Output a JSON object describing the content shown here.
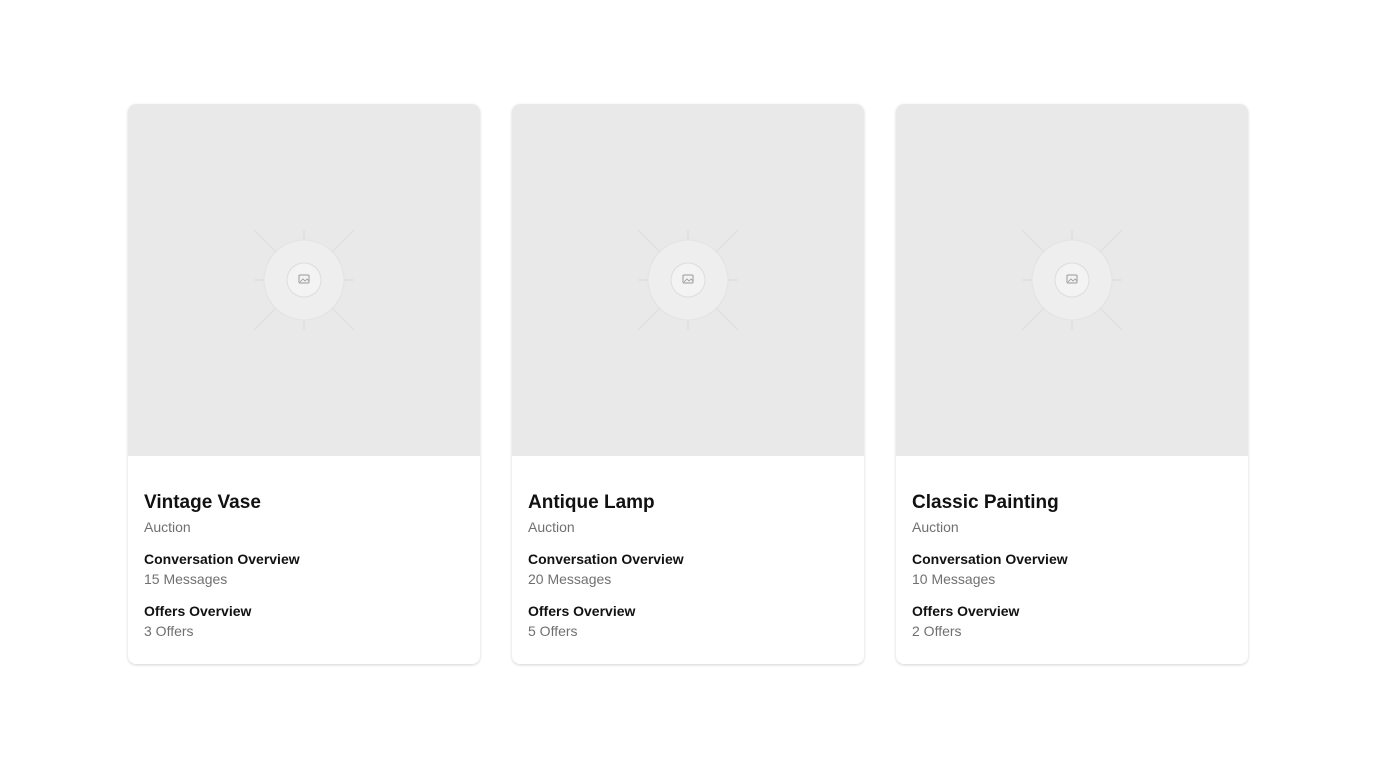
{
  "cards": [
    {
      "title": "Vintage Vase",
      "type": "Auction",
      "conversation_label": "Conversation Overview",
      "conversation_value": "15 Messages",
      "offers_label": "Offers Overview",
      "offers_value": "3 Offers",
      "image_icon": "image-placeholder-icon"
    },
    {
      "title": "Antique Lamp",
      "type": "Auction",
      "conversation_label": "Conversation Overview",
      "conversation_value": "20 Messages",
      "offers_label": "Offers Overview",
      "offers_value": "5 Offers",
      "image_icon": "image-placeholder-icon"
    },
    {
      "title": "Classic Painting",
      "type": "Auction",
      "conversation_label": "Conversation Overview",
      "conversation_value": "10 Messages",
      "offers_label": "Offers Overview",
      "offers_value": "2 Offers",
      "image_icon": "image-placeholder-icon"
    }
  ],
  "colors": {
    "placeholder_bg": "#e9e9e9",
    "title": "#111111",
    "muted": "#707070"
  }
}
